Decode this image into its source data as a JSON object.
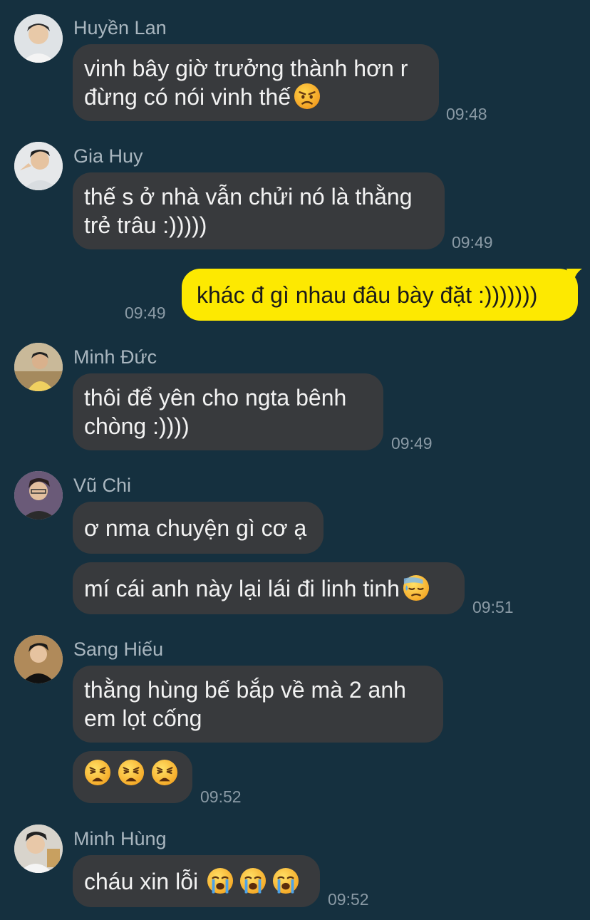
{
  "messages": [
    {
      "sender": "Huyền Lan",
      "lines": [
        "vinh bây giờ trưởng thành hơn r",
        "đừng có nói vinh thế"
      ],
      "emoji": "angry-face-icon",
      "time": "09:48"
    },
    {
      "sender": "Gia Huy",
      "lines": [
        "thế s ở nhà vẫn chửi nó là thằng",
        "trẻ trâu :)))))"
      ],
      "time": "09:49"
    },
    {
      "sender": "me",
      "lines": [
        "khác đ gì nhau đâu bày đặt :)))))))"
      ],
      "time": "09:49"
    },
    {
      "sender": "Minh Đức",
      "lines": [
        "thôi để yên cho ngta bênh",
        "chòng :))))"
      ],
      "time": "09:49"
    },
    {
      "sender": "Vũ Chi",
      "lines": [
        "ơ nma chuyện gì cơ ạ"
      ]
    },
    {
      "sender": "Vũ Chi",
      "lines": [
        "mí cái anh này lại lái đi linh tinh"
      ],
      "emoji": "downcast-face-with-sweat-icon",
      "time": "09:51"
    },
    {
      "sender": "Sang Hiếu",
      "lines": [
        "thằng hùng bế bắp về mà 2 anh",
        "em lọt cống"
      ]
    },
    {
      "sender": "Sang Hiếu",
      "emojis": [
        "weary-face-icon",
        "weary-face-icon",
        "weary-face-icon"
      ],
      "time": "09:52"
    },
    {
      "sender": "Minh Hùng",
      "lines": [
        "cháu xin lỗi"
      ],
      "emojis": [
        "loudly-crying-face-icon",
        "loudly-crying-face-icon",
        "loudly-crying-face-icon"
      ],
      "time": "09:52"
    }
  ],
  "colors": {
    "background": "#15303f",
    "incoming_bubble": "#383a3d",
    "outgoing_bubble": "#fde901",
    "sender_name": "#a9b6bf",
    "timestamp": "#8a9aa5"
  }
}
